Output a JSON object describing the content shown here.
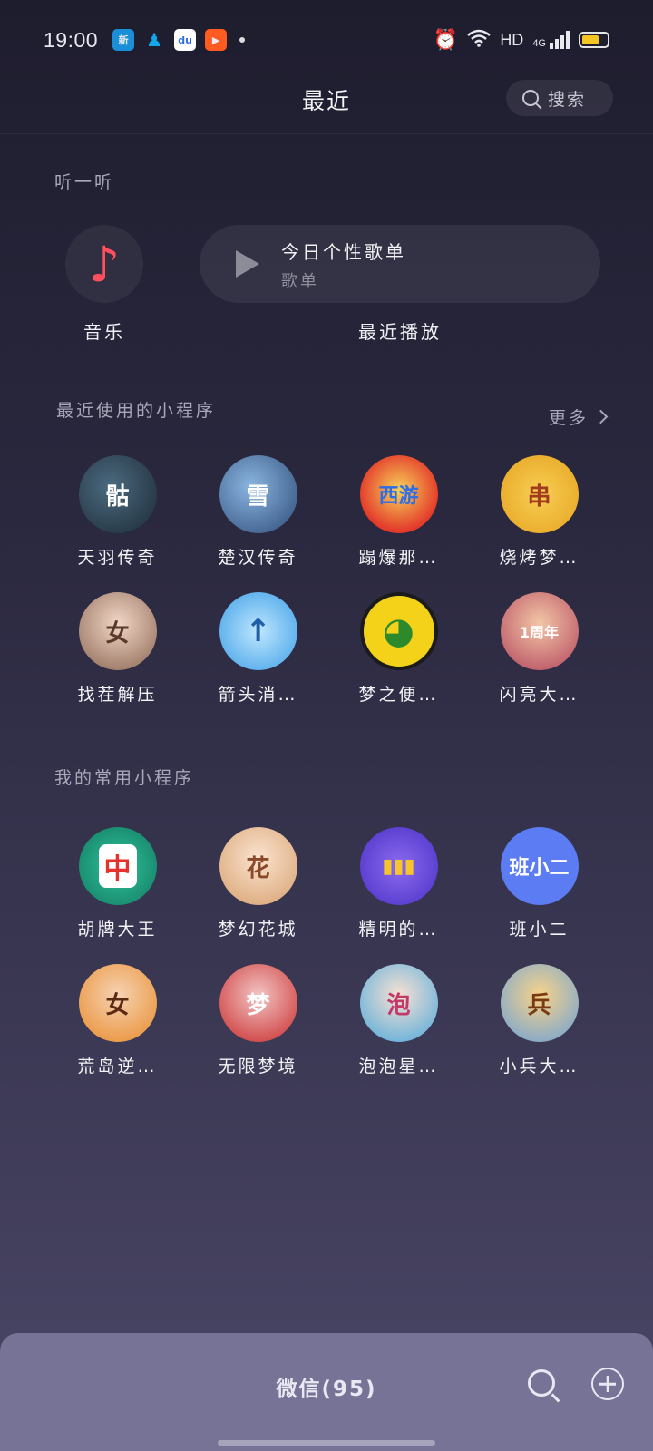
{
  "status_bar": {
    "time": "19:00",
    "network": "HD",
    "signal": "4G",
    "apps": [
      {
        "icon": "news-app-icon",
        "color": "#1a8fd8"
      },
      {
        "icon": "qq-app-icon",
        "color": "#12a7e8"
      },
      {
        "icon": "baidu-app-icon",
        "color": "#2b6ee8"
      },
      {
        "icon": "kuaishou-app-icon",
        "color": "#ff5a1f"
      }
    ],
    "battery_level": 0.7,
    "battery_color": "#f3c623"
  },
  "header": {
    "title": "最近",
    "search_label": "搜索"
  },
  "listen": {
    "section_label": "听一听",
    "music_label": "音乐",
    "music_icon": "music-note-icon",
    "music_icon_color": "#ff4f5e",
    "playlist_title": "今日个性歌单",
    "playlist_subtitle": "歌单",
    "recent_play_label": "最近播放"
  },
  "recent_mini": {
    "section_label": "最近使用的小程序",
    "more_label": "更多",
    "apps": [
      {
        "label": "天羽传奇",
        "glyph": "骷",
        "bg": "#2b3b4a"
      },
      {
        "label": "楚汉传奇",
        "glyph": "雪",
        "bg": "#3a5c8a"
      },
      {
        "label": "蹋爆那…",
        "glyph": "西游",
        "bg": "#e8412f"
      },
      {
        "label": "烧烤梦…",
        "glyph": "串",
        "bg": "#f3b82c"
      },
      {
        "label": "找茬解压",
        "glyph": "女",
        "bg": "#c79c7f"
      },
      {
        "label": "箭头消…",
        "glyph": "↑",
        "bg": "#4ab3ee"
      },
      {
        "label": "梦之便…",
        "glyph": "◕",
        "bg": "#f2d417"
      },
      {
        "label": "闪亮大…",
        "glyph": "1周年",
        "bg": "#c95a6e"
      }
    ]
  },
  "favorite_mini": {
    "section_label": "我的常用小程序",
    "apps": [
      {
        "label": "胡牌大王",
        "glyph": "中",
        "bg": "#1f9a7e"
      },
      {
        "label": "梦幻花城",
        "glyph": "花",
        "bg": "#e8c8a4"
      },
      {
        "label": "精明的…",
        "glyph": "▮▮▮",
        "bg": "#6a4be0"
      },
      {
        "label": "班小二",
        "glyph": "班小二",
        "bg": "#5b7cf2"
      },
      {
        "label": "荒岛逆…",
        "glyph": "女",
        "bg": "#f0a24a"
      },
      {
        "label": "无限梦境",
        "glyph": "梦",
        "bg": "#d83a3a"
      },
      {
        "label": "泡泡星…",
        "glyph": "泡",
        "bg": "#6cbfe8"
      },
      {
        "label": "小兵大…",
        "glyph": "兵",
        "bg": "#e2a24b"
      }
    ]
  },
  "bottom_bar": {
    "title": "微信(95)"
  }
}
